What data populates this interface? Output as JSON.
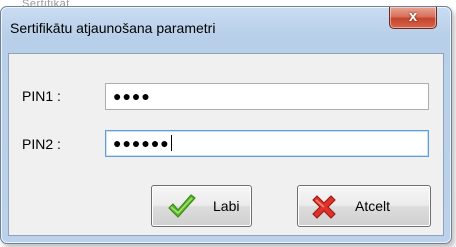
{
  "dialog": {
    "title": "Sertifikātu atjaunošana parametri",
    "close_label": "x"
  },
  "fields": {
    "pin1": {
      "label": "PIN1 :",
      "masked_value": "●●●●"
    },
    "pin2": {
      "label": "PIN2 :",
      "masked_value": "●●●●●●"
    }
  },
  "buttons": {
    "ok_label": "Labi",
    "cancel_label": "Atcelt"
  },
  "icons": {
    "ok": "checkmark-icon",
    "cancel": "cross-icon"
  },
  "colors": {
    "ok_icon": "#5cb82a",
    "cancel_icon": "#e0322a",
    "close_button": "#c5452d",
    "focus_border": "#5f9ed9"
  }
}
